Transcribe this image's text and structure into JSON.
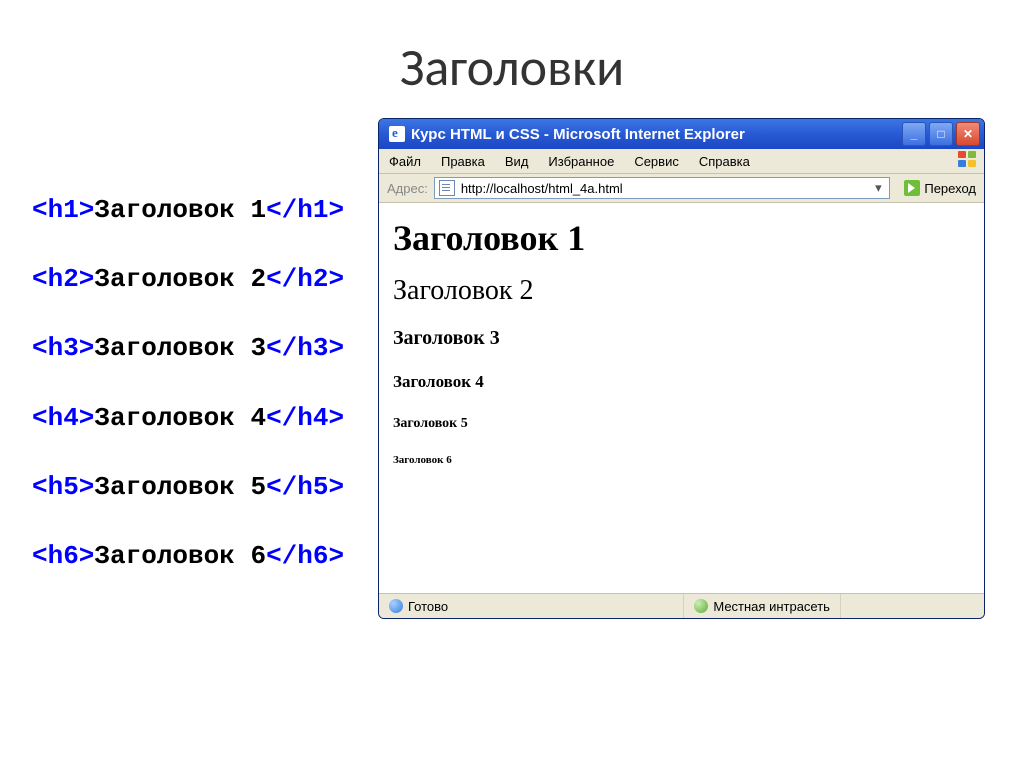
{
  "slide": {
    "title": "Заголовки"
  },
  "code": [
    {
      "open": "<h1>",
      "text": "Заголовок 1",
      "close": "</h1>"
    },
    {
      "open": "<h2>",
      "text": "Заголовок 2",
      "close": "</h2>"
    },
    {
      "open": "<h3>",
      "text": "Заголовок 3",
      "close": "</h3>"
    },
    {
      "open": "<h4>",
      "text": "Заголовок 4",
      "close": "</h4>"
    },
    {
      "open": "<h5>",
      "text": "Заголовок 5",
      "close": "</h5>"
    },
    {
      "open": "<h6>",
      "text": "Заголовок 6",
      "close": "</h6>"
    }
  ],
  "browser": {
    "title": "Курс HTML и CSS - Microsoft Internet Explorer",
    "menu": [
      "Файл",
      "Правка",
      "Вид",
      "Избранное",
      "Сервис",
      "Справка"
    ],
    "address_label": "Адрес:",
    "url": "http://localhost/html_4a.html",
    "go_label": "Переход",
    "status_left": "Готово",
    "status_right": "Местная интрасеть",
    "headings": {
      "h1": "Заголовок 1",
      "h2": "Заголовок 2",
      "h3": "Заголовок 3",
      "h4": "Заголовок 4",
      "h5": "Заголовок 5",
      "h6": "Заголовок 6"
    }
  }
}
